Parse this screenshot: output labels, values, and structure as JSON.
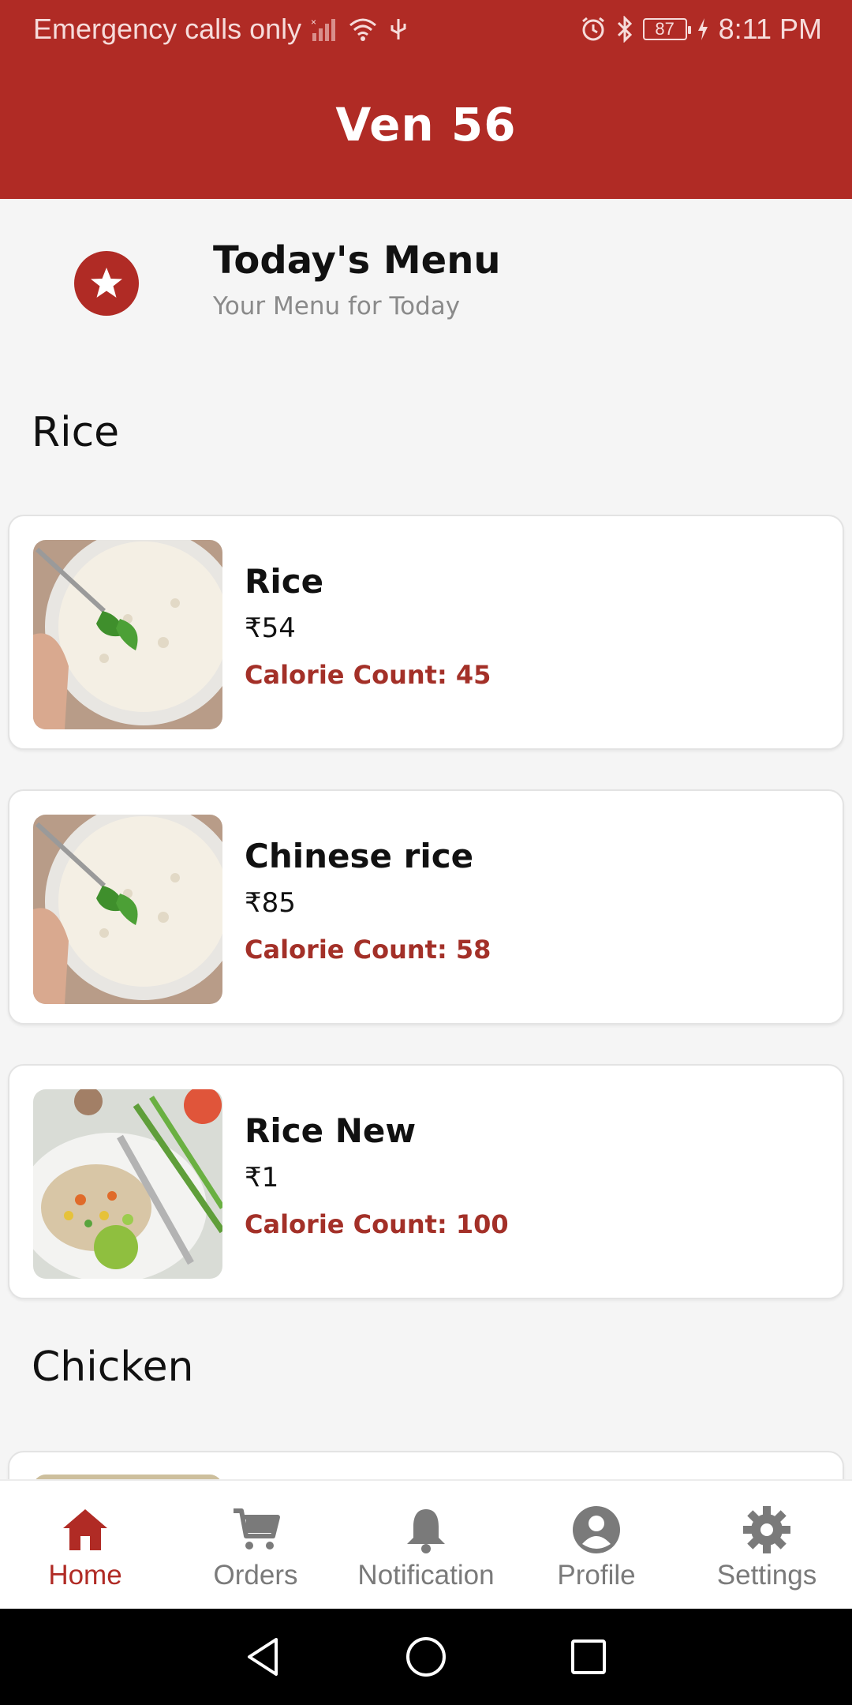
{
  "status_bar": {
    "carrier": "Emergency calls only",
    "battery": "87",
    "time": "8:11 PM"
  },
  "app": {
    "title": "Ven 56"
  },
  "menu_header": {
    "icon": "star-icon",
    "title": "Today's Menu",
    "subtitle": "Your Menu for Today"
  },
  "sections": [
    {
      "title": "Rice",
      "items": [
        {
          "name": "Rice",
          "price": "₹54",
          "calories": "Calorie Count: 45"
        },
        {
          "name": "Chinese rice",
          "price": "₹85",
          "calories": "Calorie Count: 58"
        },
        {
          "name": "Rice New",
          "price": "₹1",
          "calories": "Calorie Count: 100"
        }
      ]
    },
    {
      "title": "Chicken"
    }
  ],
  "bottom_nav": [
    {
      "label": "Home",
      "icon": "home-icon",
      "active": true
    },
    {
      "label": "Orders",
      "icon": "cart-icon"
    },
    {
      "label": "Notification",
      "icon": "bell-icon"
    },
    {
      "label": "Profile",
      "icon": "profile-icon"
    },
    {
      "label": "Settings",
      "icon": "gear-icon"
    }
  ],
  "colors": {
    "primary": "#b02b25",
    "calorie": "#a33028",
    "inactive": "#7a7a7a"
  }
}
